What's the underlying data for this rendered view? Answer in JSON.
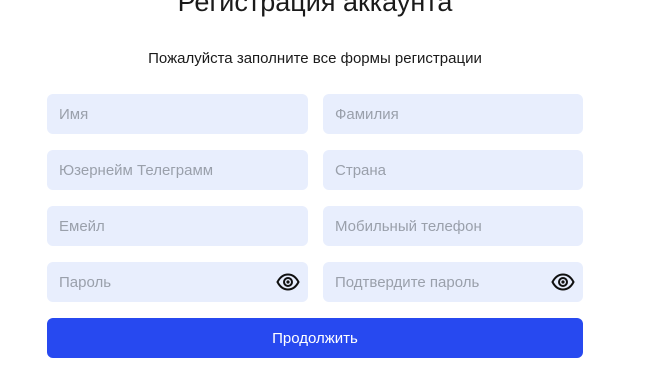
{
  "header": {
    "title": "Регистрация аккаунта",
    "subtitle": "Пожалуйста заполните все формы регистрации"
  },
  "form": {
    "first_name": {
      "placeholder": "Имя",
      "value": ""
    },
    "last_name": {
      "placeholder": "Фамилия",
      "value": ""
    },
    "telegram": {
      "placeholder": "Юзернейм Телеграмм",
      "value": ""
    },
    "country": {
      "placeholder": "Страна",
      "value": ""
    },
    "email": {
      "placeholder": "Емейл",
      "value": ""
    },
    "phone": {
      "placeholder": "Мобильный телефон",
      "value": ""
    },
    "password": {
      "placeholder": "Пароль",
      "value": "",
      "toggle_icon": "eye-icon"
    },
    "confirm_password": {
      "placeholder": "Подтвердите пароль",
      "value": "",
      "toggle_icon": "eye-icon"
    },
    "submit_label": "Продолжить"
  },
  "colors": {
    "field_background": "#e8eefd",
    "placeholder": "#9aa0ab",
    "primary_button": "#2749f0",
    "button_text": "#ffffff"
  }
}
